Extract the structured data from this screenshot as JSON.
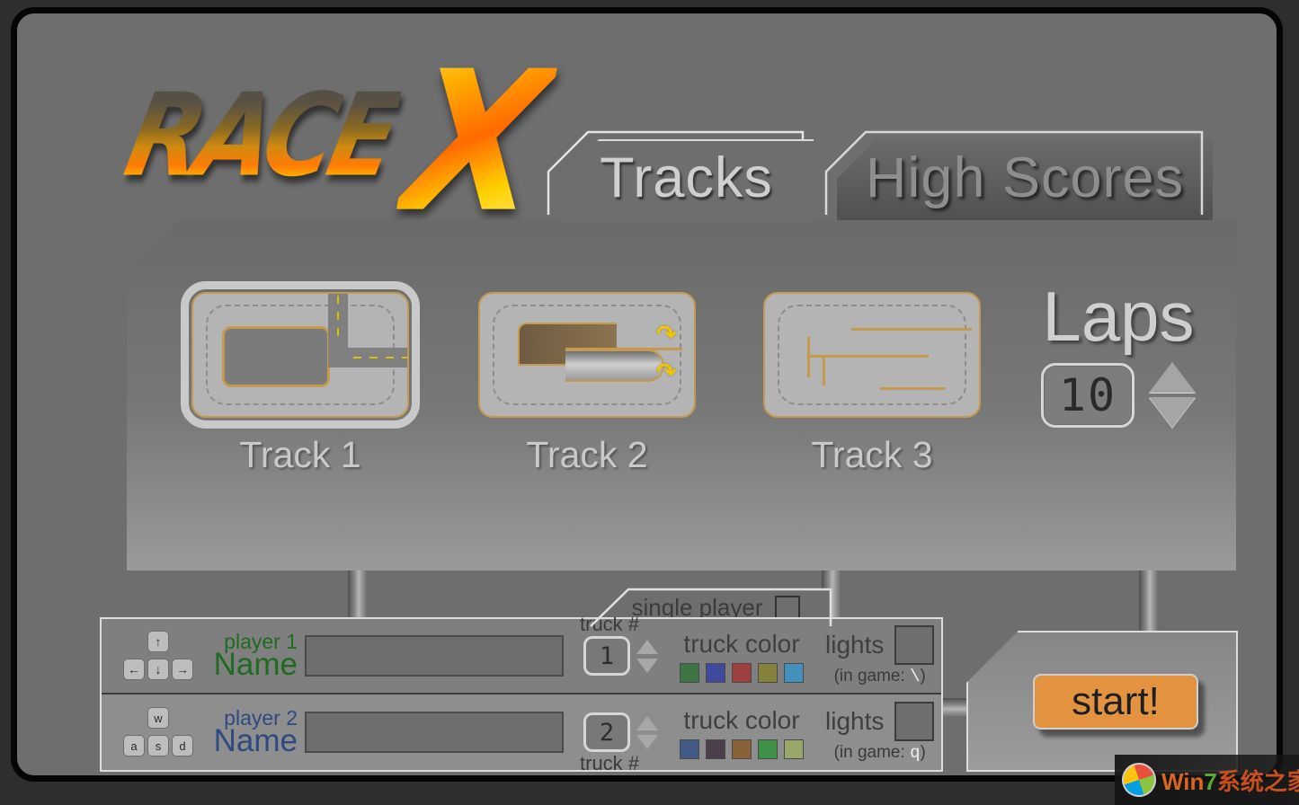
{
  "app": {
    "title": "Race X",
    "logo_main": "RACE",
    "logo_x": "X"
  },
  "tabs": [
    {
      "id": "tracks",
      "label": "Tracks",
      "active": true
    },
    {
      "id": "high-scores",
      "label": "High Scores",
      "active": false
    }
  ],
  "tracks": {
    "selected_index": 0,
    "items": [
      {
        "label": "Track 1",
        "selected": true
      },
      {
        "label": "Track 2",
        "selected": false
      },
      {
        "label": "Track 3",
        "selected": false
      }
    ]
  },
  "laps": {
    "title": "Laps",
    "value": "10",
    "increment_icon": "triangle-up-icon",
    "decrement_icon": "triangle-down-icon"
  },
  "single_player": {
    "label": "single player",
    "checked": false
  },
  "players": [
    {
      "id": "player-1",
      "keys_label": "player 1",
      "name_label": "Name",
      "name_value": "",
      "name_placeholder": "",
      "color": "#1f6b1f",
      "control_keys": [
        "↑",
        "←",
        "↓",
        "→"
      ],
      "truck_number_label": "truck #",
      "truck_number": "1",
      "truck_color_label": "truck color",
      "truck_colors": [
        "#3f7546",
        "#3f4a9e",
        "#9e4040",
        "#84823b",
        "#4390bd"
      ],
      "selected_color_index": 0,
      "lights_label": "lights",
      "lights_checked": false,
      "lights_hint": "(in game:",
      "lights_key": "\\",
      "lights_hint_close": ")"
    },
    {
      "id": "player-2",
      "keys_label": "player 2",
      "name_label": "Name",
      "name_value": "",
      "name_placeholder": "",
      "color": "#2e4a80",
      "control_keys": [
        "w",
        "a",
        "s",
        "d"
      ],
      "truck_number_label": "truck #",
      "truck_number": "2",
      "truck_color_label": "truck color",
      "truck_colors": [
        "#445a86",
        "#4b3f4c",
        "#8a6239",
        "#3f9147",
        "#9aa76b"
      ],
      "selected_color_index": 0,
      "lights_label": "lights",
      "lights_checked": false,
      "lights_hint": "(in game:",
      "lights_key": "q",
      "lights_hint_close": ")"
    }
  ],
  "start": {
    "label": "start!",
    "color": "#e3923f"
  },
  "watermark": {
    "brand_win": "Win",
    "brand_seven": "7",
    "brand_cn": "系统之家",
    "logo_icon": "windows-logo-icon"
  },
  "colors": {
    "background": "#2e2e2e",
    "window": "#6e6e6e",
    "panel_light": "#9a9a9a",
    "accent_track_border": "#c69a4e",
    "accent_start": "#e3923f",
    "text_light": "#cfcfcf"
  }
}
